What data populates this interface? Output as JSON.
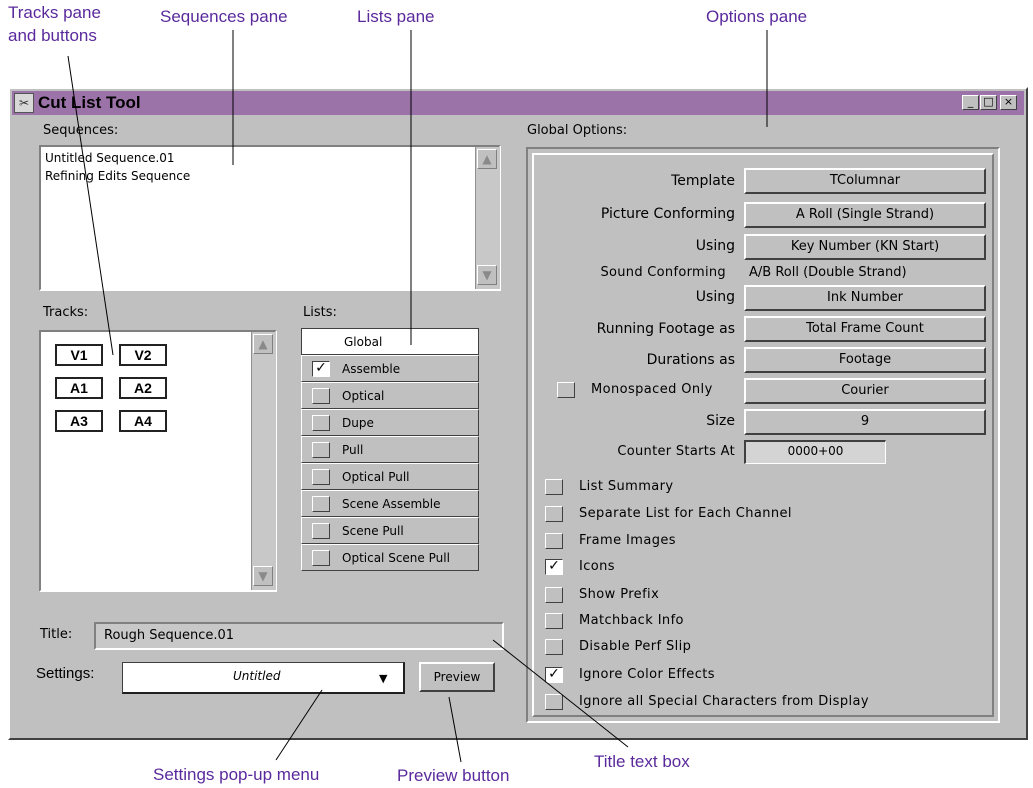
{
  "callouts": {
    "tracks_line1": "Tracks pane",
    "tracks_line2": "and buttons",
    "sequences": "Sequences pane",
    "lists": "Lists pane",
    "options": "Options pane",
    "settings": "Settings pop-up menu",
    "preview": "Preview button",
    "title_box": "Title text box"
  },
  "window": {
    "title": "Cut List Tool",
    "icon": "cut-list-app-icon",
    "controls": {
      "minimize": "_",
      "maximize": "□",
      "close": "×"
    }
  },
  "sequences": {
    "label": "Sequences:",
    "items": [
      "Untitled Sequence.01",
      "Refining Edits Sequence"
    ]
  },
  "tracks": {
    "label": "Tracks:",
    "items": [
      "V1",
      "V2",
      "A1",
      "A2",
      "A3",
      "A4"
    ]
  },
  "lists": {
    "label": "Lists:",
    "header": "Global",
    "items": [
      {
        "label": "Assemble",
        "checked": true
      },
      {
        "label": "Optical",
        "checked": false
      },
      {
        "label": "Dupe",
        "checked": false
      },
      {
        "label": "Pull",
        "checked": false
      },
      {
        "label": "Optical Pull",
        "checked": false
      },
      {
        "label": "Scene Assemble",
        "checked": false
      },
      {
        "label": "Scene Pull",
        "checked": false
      },
      {
        "label": "Optical Scene Pull",
        "checked": false
      }
    ]
  },
  "title_field": {
    "label": "Title:",
    "value": "Rough Sequence.01"
  },
  "settings": {
    "label": "Settings:",
    "value": "Untitled",
    "preview_button": "Preview"
  },
  "options": {
    "label": "Global Options:",
    "template": {
      "label": "Template",
      "value": "TColumnar"
    },
    "picture_conforming": {
      "label": "Picture Conforming",
      "value": "A Roll (Single Strand)"
    },
    "picture_using": {
      "label": "Using",
      "value": "Key Number (KN Start)"
    },
    "sound_conforming": {
      "label": "Sound Conforming",
      "value": "A/B Roll (Double Strand)"
    },
    "sound_using": {
      "label": "Using",
      "value": "Ink Number"
    },
    "running_footage": {
      "label": "Running Footage as",
      "value": "Total Frame Count"
    },
    "durations": {
      "label": "Durations as",
      "value": "Footage"
    },
    "monospaced": {
      "label": "Monospaced Only",
      "checked": false,
      "value": "Courier"
    },
    "size": {
      "label": "Size",
      "value": "9"
    },
    "counter": {
      "label": "Counter Starts At",
      "value": "0000+00"
    },
    "checkboxes": [
      {
        "label": "List Summary",
        "checked": false
      },
      {
        "label": "Separate List for Each Channel",
        "checked": false
      },
      {
        "label": "Frame Images",
        "checked": false
      },
      {
        "label": "Icons",
        "checked": true
      },
      {
        "label": "Show Prefix",
        "checked": false
      },
      {
        "label": "Matchback Info",
        "checked": false
      },
      {
        "label": "Disable Perf Slip",
        "checked": false
      },
      {
        "label": "Ignore Color Effects",
        "checked": true
      },
      {
        "label": "Ignore all Special Characters from Display",
        "checked": false
      }
    ]
  },
  "colors": {
    "titlebar": "#9c73a8",
    "callout_text": "#5a2a9c",
    "window_bg": "#c0c0c0"
  }
}
